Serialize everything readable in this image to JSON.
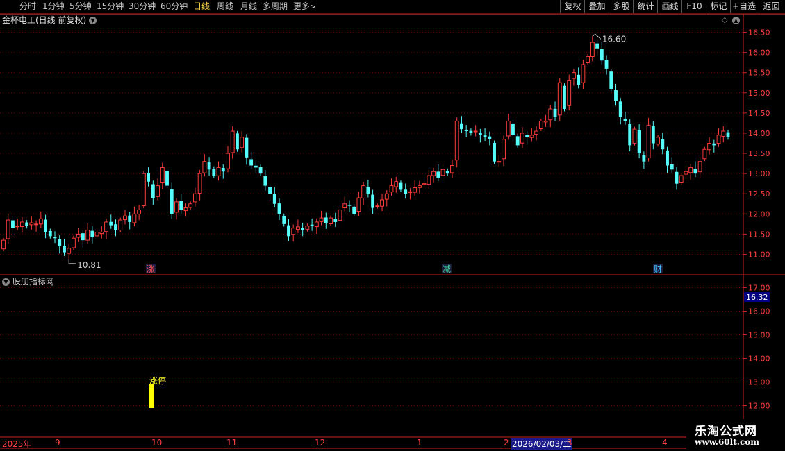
{
  "toolbar": {
    "periods": [
      "分时",
      "1分钟",
      "5分钟",
      "15分钟",
      "30分钟",
      "60分钟",
      "日线",
      "周线",
      "月线",
      "多周期",
      "更多"
    ],
    "active_period": "日线",
    "right_buttons": [
      "复权",
      "叠加",
      "多股",
      "统计",
      "画线",
      "F10",
      "标记",
      "+自选",
      "返回"
    ]
  },
  "main_chart": {
    "title": "金杯电工(日线 前复权)",
    "y_ticks": [
      "16.50",
      "16.00",
      "15.50",
      "15.00",
      "14.50",
      "14.00",
      "13.50",
      "13.00",
      "12.50",
      "12.00",
      "11.50",
      "11.00"
    ],
    "high_label": "16.60",
    "low_label": "10.81",
    "markers": [
      {
        "text": "涨",
        "color": "#ff5050"
      },
      {
        "text": "减",
        "color": "#40e0a0"
      },
      {
        "text": "财",
        "color": "#40c0ff"
      }
    ]
  },
  "indicator": {
    "title": "股朋指标网",
    "y_ticks": [
      "17.00",
      "16.00",
      "15.00",
      "14.00",
      "13.00",
      "12.00"
    ],
    "current_value": "16.32",
    "signal_label": "涨停"
  },
  "x_axis": {
    "labels": [
      "2025年",
      "9",
      "10",
      "11",
      "12",
      "1",
      "2",
      "2026/02/03/二",
      "3",
      "4"
    ]
  },
  "watermark": {
    "line1": "乐淘公式网",
    "line2": "www.60lt.com"
  },
  "chart_data": {
    "type": "candlestick",
    "title": "金杯电工(日线 前复权)",
    "ylim": [
      10.75,
      16.75
    ],
    "up_color": "#ff3c3c",
    "down_color": "#54fcfc",
    "closes": [
      11.35,
      11.85,
      11.65,
      11.7,
      11.8,
      11.7,
      11.78,
      11.75,
      11.88,
      11.55,
      11.45,
      11.4,
      11.2,
      11.05,
      11.15,
      11.4,
      11.5,
      11.35,
      11.6,
      11.42,
      11.55,
      11.55,
      11.8,
      11.72,
      11.6,
      11.85,
      11.95,
      11.8,
      12.0,
      12.1,
      13.0,
      12.8,
      12.4,
      12.7,
      13.15,
      12.7,
      12.0,
      12.3,
      12.1,
      12.15,
      12.25,
      12.5,
      13.0,
      13.3,
      13.1,
      12.95,
      13.15,
      13.05,
      13.5,
      14.05,
      13.6,
      13.9,
      13.4,
      13.2,
      13.15,
      13.0,
      12.7,
      12.5,
      12.25,
      12.0,
      11.75,
      11.45,
      11.65,
      11.68,
      11.6,
      11.7,
      11.7,
      11.8,
      11.9,
      11.78,
      11.9,
      11.8,
      12.1,
      12.25,
      12.2,
      12.0,
      12.4,
      12.7,
      12.5,
      12.15,
      12.2,
      12.35,
      12.5,
      12.7,
      12.8,
      12.6,
      12.5,
      12.55,
      12.65,
      12.7,
      12.75,
      12.95,
      13.05,
      12.9,
      13.1,
      13.0,
      13.2,
      14.3,
      14.1,
      14.05,
      14.0,
      14.05,
      13.95,
      13.9,
      13.85,
      13.3,
      13.3,
      13.85,
      14.3,
      13.95,
      13.7,
      14.0,
      13.9,
      13.95,
      14.05,
      14.3,
      14.3,
      14.6,
      14.4,
      15.25,
      14.6,
      15.3,
      15.5,
      15.2,
      15.7,
      15.9,
      16.25,
      16.1,
      15.8,
      15.6,
      15.1,
      14.8,
      14.4,
      14.3,
      13.7,
      14.1,
      13.5,
      13.3,
      14.2,
      13.75,
      13.9,
      13.6,
      13.2,
      13.1,
      12.75,
      12.95,
      13.05,
      13.15,
      13.0,
      13.3,
      13.6,
      13.75,
      13.7,
      13.95,
      14.05,
      13.9
    ]
  }
}
